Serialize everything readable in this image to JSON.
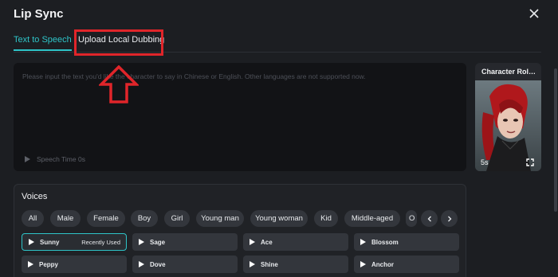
{
  "dialog": {
    "title": "Lip Sync"
  },
  "tabs": [
    {
      "label": "Text to Speech",
      "active": true
    },
    {
      "label": "Upload Local Dubbing",
      "active": false
    }
  ],
  "text_input": {
    "placeholder": "Please input the text you'd like the character to say in Chinese or English. Other languages are not supported now.",
    "speech_time_label": "Speech Time 0s"
  },
  "character": {
    "title": "Character Rol…",
    "duration": "5s"
  },
  "voices": {
    "title": "Voices",
    "filters": [
      "All",
      "Male",
      "Female",
      "Boy",
      "Girl",
      "Young man",
      "Young woman",
      "Kid",
      "Middle-aged",
      "O"
    ],
    "items": [
      {
        "name": "Sunny",
        "tag": "Recently Used",
        "selected": true
      },
      {
        "name": "Sage",
        "tag": "",
        "selected": false
      },
      {
        "name": "Ace",
        "tag": "",
        "selected": false
      },
      {
        "name": "Blossom",
        "tag": "",
        "selected": false
      },
      {
        "name": "Peppy",
        "tag": "",
        "selected": false
      },
      {
        "name": "Dove",
        "tag": "",
        "selected": false
      },
      {
        "name": "Shine",
        "tag": "",
        "selected": false
      },
      {
        "name": "Anchor",
        "tag": "",
        "selected": false
      }
    ]
  },
  "colors": {
    "accent": "#2ec4c8",
    "annotation_red": "#e0252a",
    "background": "#1c1e22"
  },
  "icons": {
    "close": "close-icon",
    "play": "play-icon",
    "prev": "chevron-left-icon",
    "next": "chevron-right-icon",
    "expand": "expand-icon",
    "annotation_arrow": "up-arrow-icon"
  }
}
